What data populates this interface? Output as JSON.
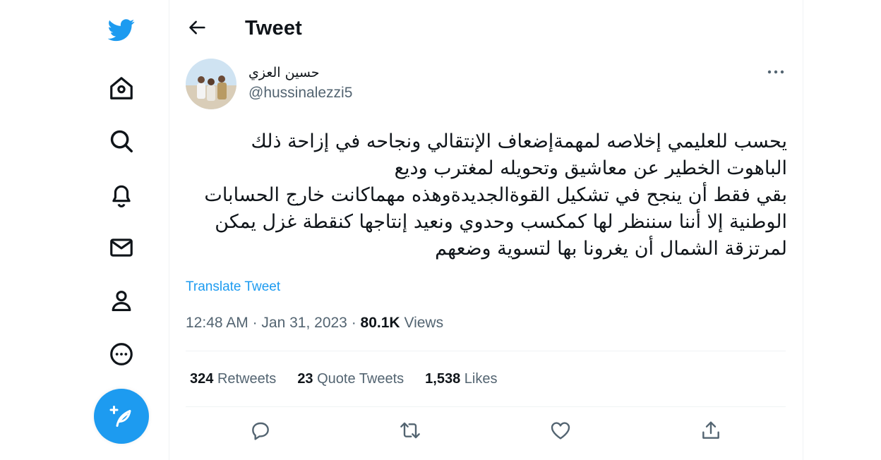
{
  "colors": {
    "brand": "#1d9bf0",
    "text": "#0f1419",
    "muted": "#536471",
    "border": "#eff3f4"
  },
  "sidebar": {
    "icons": [
      "twitter-logo-icon",
      "home-icon",
      "explore-search-icon",
      "notifications-bell-icon",
      "messages-envelope-icon",
      "profile-person-icon",
      "more-circle-icon"
    ],
    "compose_icon": "compose-feather-plus-icon"
  },
  "header": {
    "title": "Tweet",
    "back_icon": "arrow-left-icon"
  },
  "tweet": {
    "author": {
      "display_name": "حسين العزي",
      "handle": "@hussinalezzi5"
    },
    "text": "يحسب للعليمي إخلاصه لمهمةإضعاف الإنتقالي ونجاحه في إزاحة ذلك الباهوت الخطير عن معاشيق وتحويله لمغترب وديع\nبقي فقط أن ينجح في تشكيل القوةالجديدةوهذه مهماكانت خارج الحسابات الوطنية إلا أننا سننظر لها كمكسب وحدوي ونعيد إنتاجها كنقطة غزل يمكن لمرتزقة الشمال أن يغرونا بها لتسوية وضعهم",
    "translate_label": "Translate Tweet",
    "time": "12:48 AM",
    "date": "Jan 31, 2023",
    "separator": "·",
    "views_count": "80.1K",
    "views_label": "Views"
  },
  "stats": {
    "retweets": {
      "count": "324",
      "label": "Retweets"
    },
    "quote_tweets": {
      "count": "23",
      "label": "Quote Tweets"
    },
    "likes": {
      "count": "1,538",
      "label": "Likes"
    }
  },
  "actions": [
    "reply-icon",
    "retweet-icon",
    "like-heart-icon",
    "share-upload-icon"
  ]
}
